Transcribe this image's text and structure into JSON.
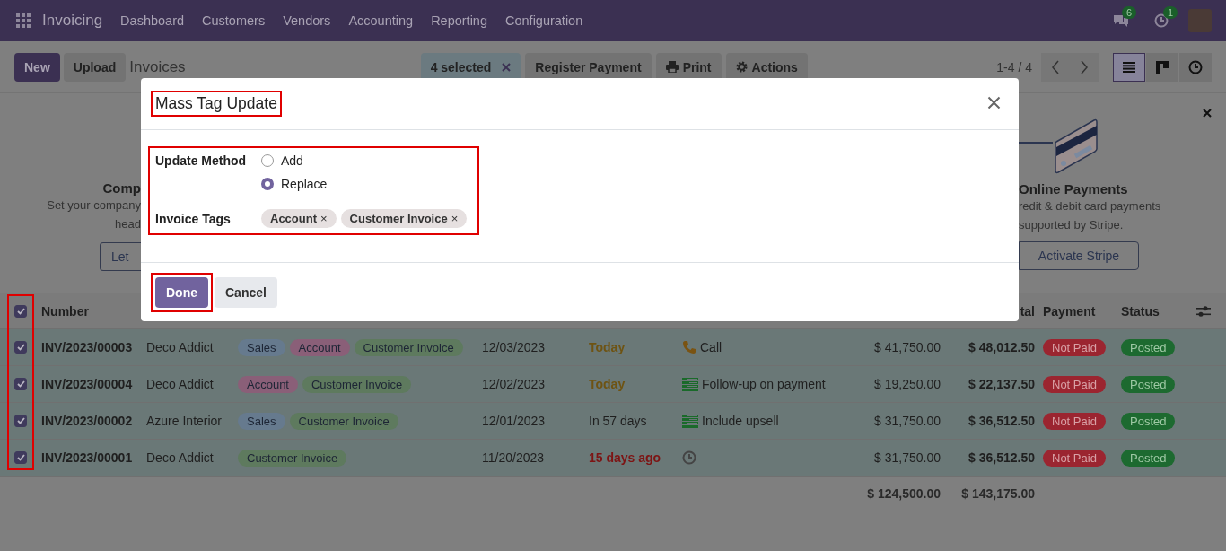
{
  "navbar": {
    "app_name": "Invoicing",
    "menu": [
      "Dashboard",
      "Customers",
      "Vendors",
      "Accounting",
      "Reporting",
      "Configuration"
    ],
    "messages_badge": "6",
    "activities_badge": "1"
  },
  "control_panel": {
    "new_button": "New",
    "upload_button": "Upload",
    "breadcrumb": "Invoices",
    "selection": "4 selected",
    "actions": [
      {
        "kind": "plain",
        "label": "Register Payment"
      },
      {
        "kind": "print",
        "label": "Print"
      },
      {
        "kind": "gear",
        "label": "Actions"
      }
    ],
    "pager": "1-4 / 4",
    "views": [
      {
        "kind": "list",
        "selected": true
      },
      {
        "kind": "kanban",
        "selected": false
      },
      {
        "kind": "activity",
        "selected": false
      }
    ]
  },
  "banner": {
    "left": {
      "title": "Comp",
      "lines": [
        "Set your company",
        "head"
      ],
      "button": "Let"
    },
    "right": {
      "title": "Online Payments",
      "lines": [
        "redit & debit card payments",
        "supported by Stripe."
      ],
      "button": "Activate Stripe"
    }
  },
  "dialog": {
    "title": "Mass Tag Update",
    "fields": [
      {
        "kind": "radio",
        "label": "Update Method",
        "options": [
          {
            "label": "Add",
            "selected": false
          },
          {
            "label": "Replace",
            "selected": true
          }
        ]
      },
      {
        "kind": "tags",
        "label": "Invoice Tags",
        "tags": [
          {
            "label": "Account",
            "remove": "×"
          },
          {
            "label": "Customer Invoice",
            "remove": "×"
          }
        ]
      }
    ],
    "buttons": [
      {
        "kind": "primary",
        "label": "Done"
      },
      {
        "kind": "secondary",
        "label": "Cancel"
      }
    ]
  },
  "table": {
    "all_checked": true,
    "columns": [
      "Number",
      "tal",
      "Payment",
      "Status"
    ],
    "rows": [
      {
        "checked": true,
        "number": "INV/2023/00003",
        "customer": "Deco Addict",
        "tags": [
          {
            "label": "Sales",
            "color": "#667a8e"
          },
          {
            "label": "Account",
            "color": "#8a5f78"
          },
          {
            "label": "Customer Invoice",
            "color": "#5e7a5e"
          }
        ],
        "date": "12/03/2023",
        "due": {
          "text": "Today",
          "color": "#6e5312"
        },
        "activity": {
          "kind": "phone",
          "text": "Call"
        },
        "untaxed": "$ 41,750.00",
        "total": "$ 48,012.50",
        "payment": "Not Paid",
        "status": "Posted"
      },
      {
        "checked": true,
        "number": "INV/2023/00004",
        "customer": "Deco Addict",
        "tags": [
          {
            "label": "Account",
            "color": "#8a5f78"
          },
          {
            "label": "Customer Invoice",
            "color": "#5e7a5e"
          }
        ],
        "date": "12/02/2023",
        "due": {
          "text": "Today",
          "color": "#6e5312"
        },
        "activity": {
          "kind": "todo",
          "text": "Follow-up on payment"
        },
        "untaxed": "$ 19,250.00",
        "total": "$ 22,137.50",
        "payment": "Not Paid",
        "status": "Posted"
      },
      {
        "checked": true,
        "number": "INV/2023/00002",
        "customer": "Azure Interior",
        "tags": [
          {
            "label": "Sales",
            "color": "#667a8e"
          },
          {
            "label": "Customer Invoice",
            "color": "#5e7a5e"
          }
        ],
        "date": "12/01/2023",
        "due": {
          "text": "In 57 days",
          "color": "#1f1f1f"
        },
        "activity": {
          "kind": "todo",
          "text": "Include upsell"
        },
        "untaxed": "$ 31,750.00",
        "total": "$ 36,512.50",
        "payment": "Not Paid",
        "status": "Posted"
      },
      {
        "checked": true,
        "number": "INV/2023/00001",
        "customer": "Deco Addict",
        "tags": [
          {
            "label": "Customer Invoice",
            "color": "#5e7a5e"
          }
        ],
        "date": "11/20/2023",
        "due": {
          "text": "15 days ago",
          "color": "#7d1414"
        },
        "activity": {
          "kind": "none"
        },
        "untaxed": "$ 31,750.00",
        "total": "$ 36,512.50",
        "payment": "Not Paid",
        "status": "Posted"
      }
    ],
    "totals": {
      "untaxed": "$ 124,500.00",
      "total": "$ 143,175.00"
    }
  }
}
